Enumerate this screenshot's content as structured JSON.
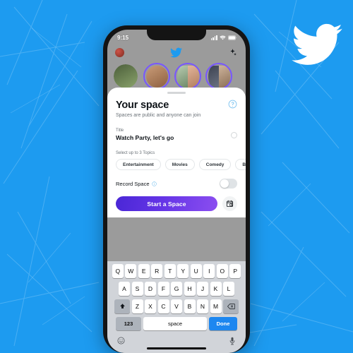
{
  "background": {
    "color": "#1d9bf0",
    "brand_logo": "twitter-bird-icon"
  },
  "phone": {
    "status_bar": {
      "time": "9:15",
      "signal_icon": "cellular-signal-icon",
      "wifi_icon": "wifi-icon",
      "battery_icon": "battery-icon"
    },
    "app_header": {
      "avatar": "profile-avatar",
      "logo_icon": "twitter-bird-icon",
      "sparkle_icon": "sparkle-icon"
    },
    "spaces_strip": {
      "bubbles": [
        {
          "ring": false
        },
        {
          "ring": true
        },
        {
          "ring": true
        },
        {
          "ring": true
        }
      ]
    }
  },
  "sheet": {
    "title": "Your space",
    "subtitle": "Spaces are public and anyone can join",
    "help_icon": "help-circle-icon",
    "title_field": {
      "label": "Title",
      "value": "Watch Party, let's go"
    },
    "topics": {
      "label": "Select up to 3 Topics",
      "chips": [
        "Entertainment",
        "Movies",
        "Comedy",
        "B"
      ]
    },
    "record": {
      "label": "Record Space",
      "info_icon": "info-circle-icon",
      "enabled": false
    },
    "cta": {
      "label": "Start a Space",
      "schedule_icon": "schedule-clock-icon",
      "gradient_from": "#4a27d6",
      "gradient_to": "#8b4ef0"
    }
  },
  "keyboard": {
    "row1": [
      "Q",
      "W",
      "E",
      "R",
      "T",
      "Y",
      "U",
      "I",
      "O",
      "P"
    ],
    "row2": [
      "A",
      "S",
      "D",
      "F",
      "G",
      "H",
      "J",
      "K",
      "L"
    ],
    "row3": [
      "Z",
      "X",
      "C",
      "V",
      "B",
      "N",
      "M"
    ],
    "shift_icon": "shift-icon",
    "backspace_icon": "backspace-icon",
    "numbers_key": "123",
    "space_key": "space",
    "done_key": "Done",
    "emoji_icon": "emoji-icon",
    "mic_icon": "microphone-icon"
  }
}
